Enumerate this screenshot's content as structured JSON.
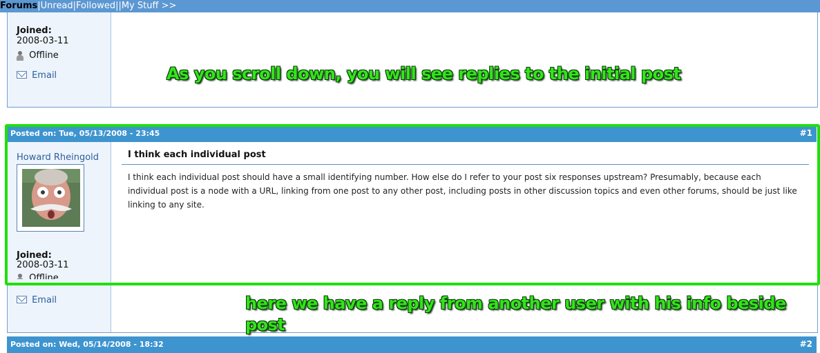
{
  "nav": {
    "forums": "Forums",
    "items": [
      "Unread",
      "Followed",
      "",
      "My Stuff >>"
    ],
    "separator": "|"
  },
  "post0": {
    "joined_label": "Joined:",
    "joined_date": "2008-03-11",
    "status": "Offline",
    "email": "Email"
  },
  "annotation1": "As you scroll down, you will see replies to the initial post",
  "post1": {
    "posted": "Posted on: Tue, 05/13/2008 - 23:45",
    "number": "#1",
    "author": "Howard Rheingold",
    "title": "I think each individual post",
    "body": "I think each individual post should have a small identifying number. How else do I refer to your post six responses upstream? Presumably, because each individual post is a node with a URL, linking from one post to any other post, including posts in other discussion topics and even other forums, should be just like linking to any site.",
    "joined_label": "Joined:",
    "joined_date": "2008-03-11",
    "status": "Offline",
    "email": "Email"
  },
  "annotation2": "here we have a reply from another user with his info beside post",
  "post2": {
    "posted": "Posted on: Wed, 05/14/2008 - 18:32",
    "number": "#2"
  },
  "colors": {
    "nav_bg": "#5b97d2",
    "header_bg": "#3e94cf",
    "sidebar_bg": "#edf4fb",
    "highlight_frame": "#1ee00a",
    "annotation_text": "#33e41a"
  }
}
